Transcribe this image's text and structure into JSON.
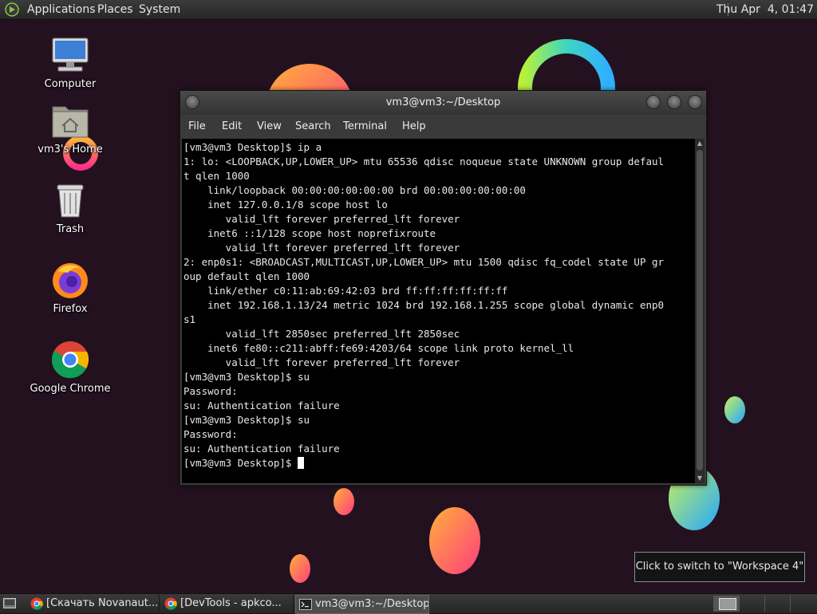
{
  "top_panel": {
    "menus": [
      "Applications",
      "Places",
      "System"
    ],
    "clock": "Thu Apr  4, 01:47"
  },
  "desktop_icons": [
    {
      "label": "Computer",
      "icon": "computer-icon"
    },
    {
      "label": "vm3's Home",
      "icon": "home-folder-icon"
    },
    {
      "label": "Trash",
      "icon": "trash-icon"
    },
    {
      "label": "Firefox",
      "icon": "firefox-icon"
    },
    {
      "label": "Google Chrome",
      "icon": "chrome-icon"
    }
  ],
  "terminal": {
    "title": "vm3@vm3:~/Desktop",
    "menu": [
      "File",
      "Edit",
      "View",
      "Search",
      "Terminal",
      "Help"
    ],
    "lines": [
      "[vm3@vm3 Desktop]$ ip a",
      "1: lo: <LOOPBACK,UP,LOWER_UP> mtu 65536 qdisc noqueue state UNKNOWN group defaul",
      "t qlen 1000",
      "    link/loopback 00:00:00:00:00:00 brd 00:00:00:00:00:00",
      "    inet 127.0.0.1/8 scope host lo",
      "       valid_lft forever preferred_lft forever",
      "    inet6 ::1/128 scope host noprefixroute",
      "       valid_lft forever preferred_lft forever",
      "2: enp0s1: <BROADCAST,MULTICAST,UP,LOWER_UP> mtu 1500 qdisc fq_codel state UP gr",
      "oup default qlen 1000",
      "    link/ether c0:11:ab:69:42:03 brd ff:ff:ff:ff:ff:ff",
      "    inet 192.168.1.13/24 metric 1024 brd 192.168.1.255 scope global dynamic enp0",
      "s1",
      "       valid_lft 2850sec preferred_lft 2850sec",
      "    inet6 fe80::c211:abff:fe69:4203/64 scope link proto kernel_ll",
      "       valid_lft forever preferred_lft forever",
      "[vm3@vm3 Desktop]$ su",
      "Password:",
      "su: Authentication failure",
      "[vm3@vm3 Desktop]$ su",
      "Password:",
      "su: Authentication failure"
    ],
    "prompt": "[vm3@vm3 Desktop]$ "
  },
  "tooltip": "Click to switch to \"Workspace 4\"",
  "taskbar": {
    "tasks": [
      {
        "label": "[Скачать Novanaut...",
        "icon": "chrome-icon",
        "active": false
      },
      {
        "label": "[DevTools - apkco...",
        "icon": "chrome-icon",
        "active": false
      },
      {
        "label": "vm3@vm3:~/Desktop",
        "icon": "terminal-icon",
        "active": true
      }
    ]
  }
}
